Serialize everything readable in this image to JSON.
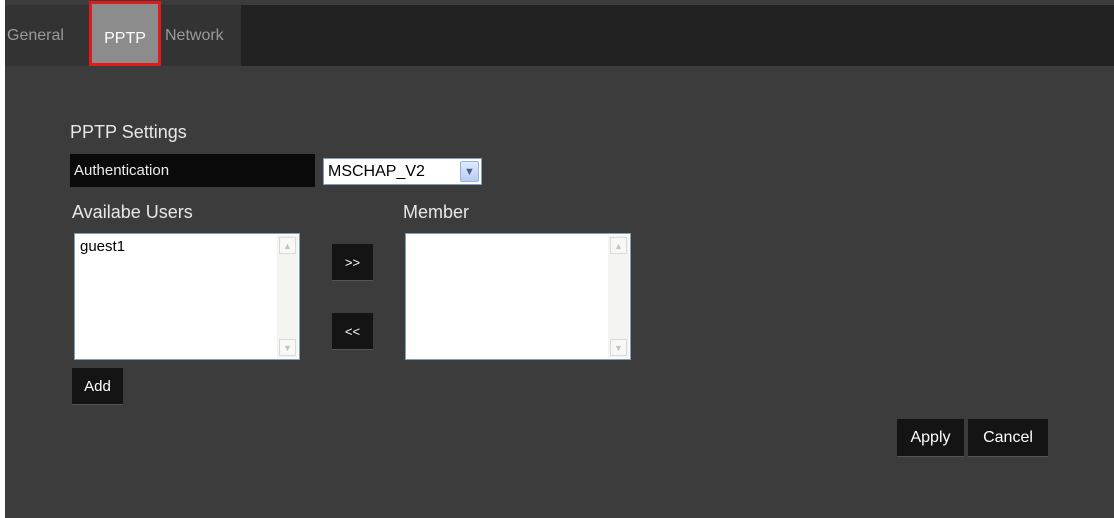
{
  "tabs": [
    {
      "label": "General",
      "active": false
    },
    {
      "label": "PPTP",
      "active": true
    },
    {
      "label": "Network",
      "active": false
    }
  ],
  "pptp": {
    "section_title": "PPTP Settings",
    "auth_label": "Authentication",
    "auth_selected": "MSCHAP_V2"
  },
  "lists": {
    "available_label": "Availabe Users",
    "available_users": [
      "guest1"
    ],
    "member_label": "Member",
    "members": []
  },
  "buttons": {
    "move_right": ">>",
    "move_left": "<<",
    "add": "Add",
    "apply": "Apply",
    "cancel": "Cancel"
  },
  "icons": {
    "dropdown": "chevron-down-icon",
    "scroll_up": "scroll-up-arrow-icon",
    "scroll_down": "scroll-down-arrow-icon"
  },
  "colors": {
    "tab_highlight_border": "#e01b1b",
    "panel_background": "#3c3c3c",
    "tabbar_background": "#222222"
  }
}
